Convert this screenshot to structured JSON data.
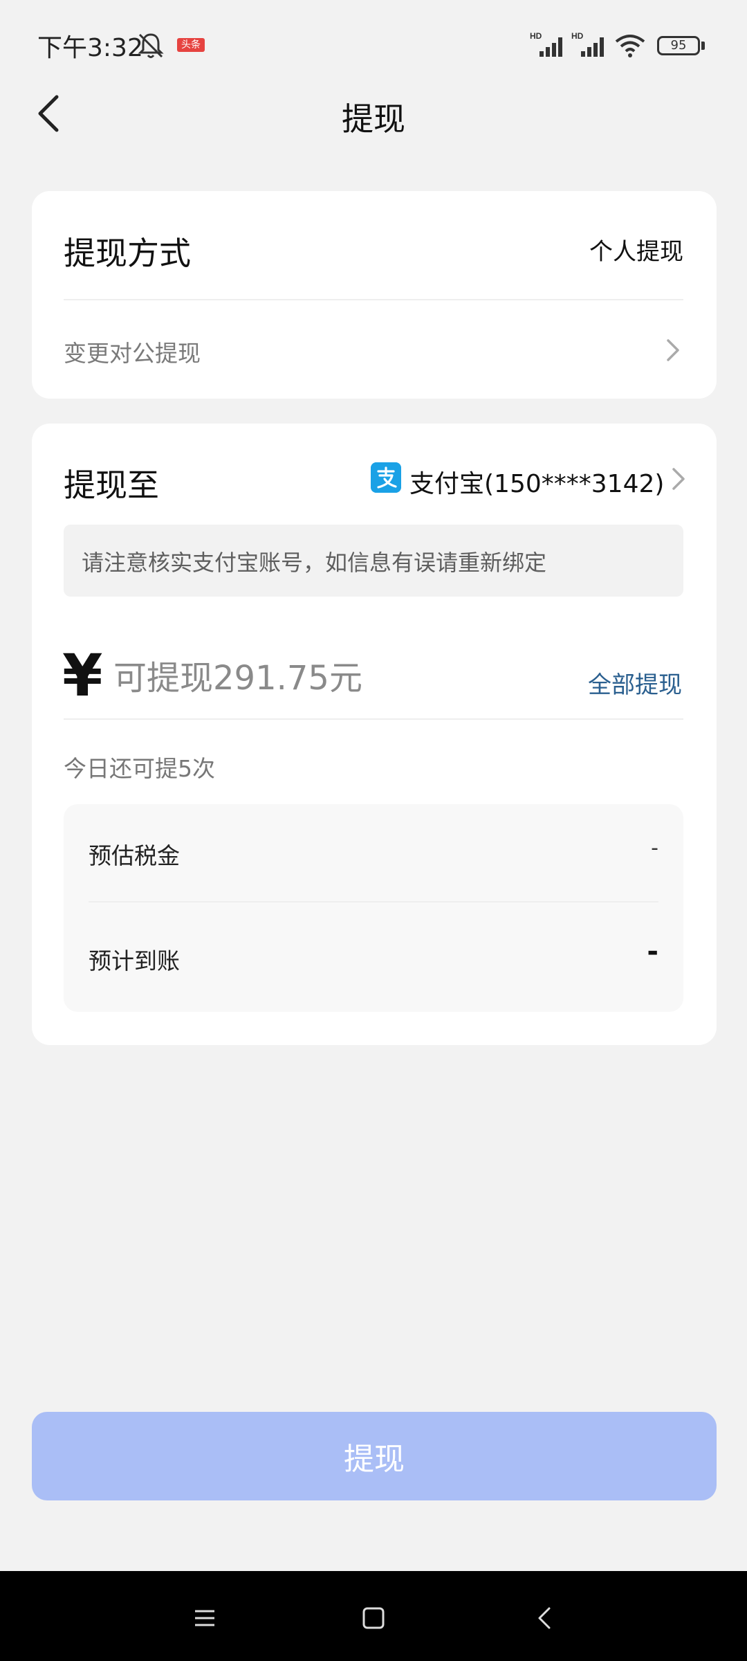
{
  "status_bar": {
    "time": "下午3:32",
    "app_badge": "头条",
    "battery": "95",
    "signal_label_1": "HD",
    "signal_label_2": "HD"
  },
  "header": {
    "title": "提现"
  },
  "method_card": {
    "label": "提现方式",
    "value": "个人提现",
    "change_link": "变更对公提现"
  },
  "target_card": {
    "label": "提现至",
    "account": "支付宝(150****3142)",
    "notice": "请注意核实支付宝账号，如信息有误请重新绑定",
    "currency_symbol": "¥",
    "amount_placeholder": "可提现291.75元",
    "withdraw_all": "全部提现",
    "remaining_times": "今日还可提5次",
    "details": [
      {
        "label": "预估税金",
        "value": "-"
      },
      {
        "label": "预计到账",
        "value": "-"
      }
    ]
  },
  "submit_button": "提现",
  "colors": {
    "accent_link": "#2a5f8f",
    "button_disabled": "#aabef6",
    "alipay_blue": "#1aa1e6",
    "background": "#f2f2f2"
  },
  "icons": [
    "mute-bell-icon",
    "signal-icon",
    "wifi-icon",
    "battery-icon",
    "back-arrow-icon",
    "chevron-right-icon",
    "alipay-logo-icon",
    "menu-icon",
    "home-icon",
    "back-nav-icon"
  ]
}
